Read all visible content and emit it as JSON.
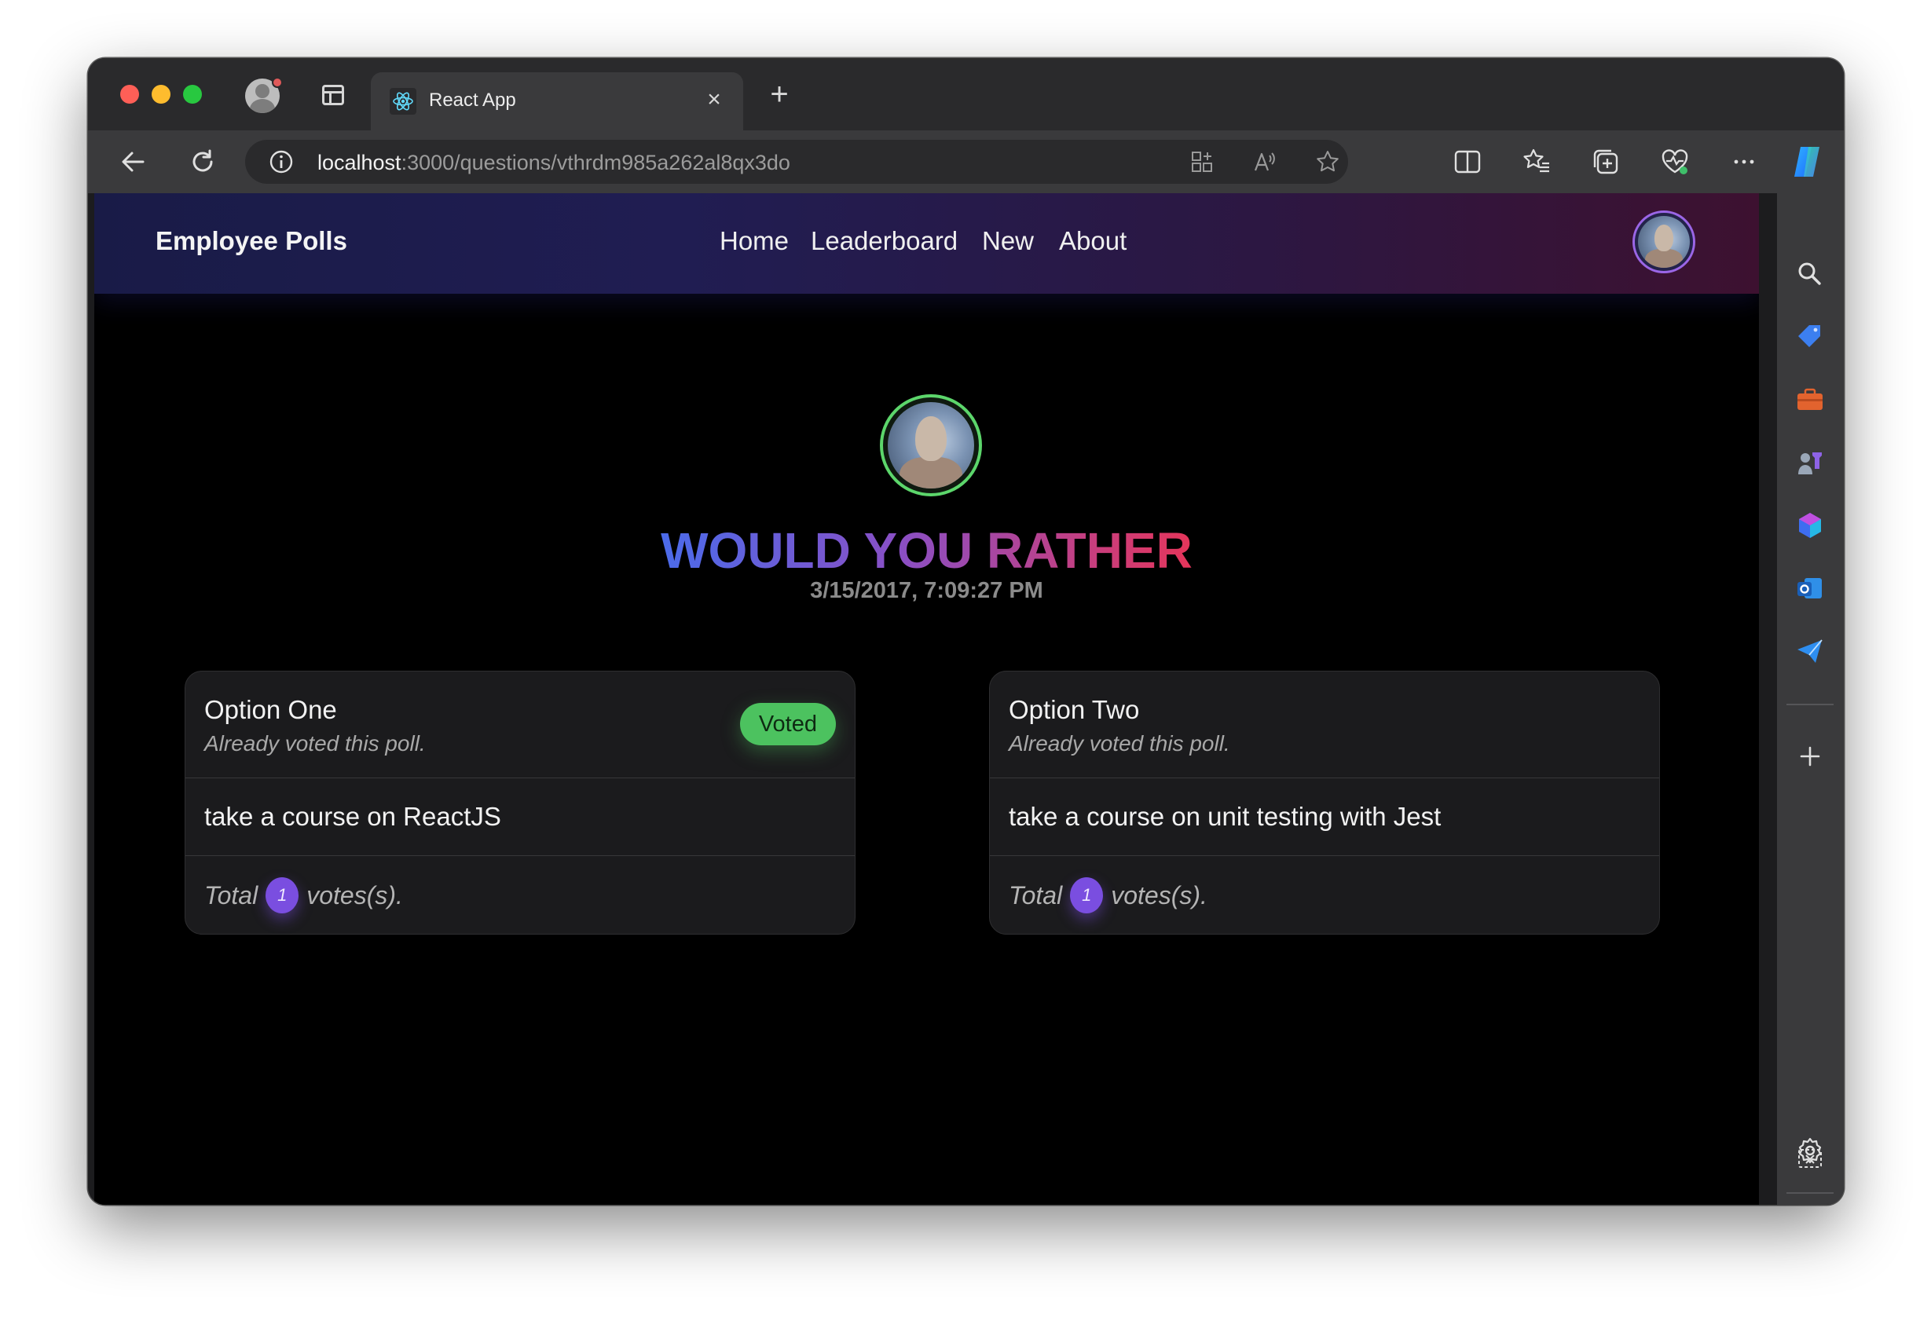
{
  "browser": {
    "tab_title": "React App",
    "tab_close_icon": "×",
    "new_tab_icon": "+",
    "url_host": "localhost",
    "url_rest": ":3000/questions/vthrdm985a262al8qx3do"
  },
  "app": {
    "brand": "Employee Polls",
    "nav": [
      "Home",
      "Leaderboard",
      "New",
      "About"
    ]
  },
  "poll": {
    "title": "WOULD YOU RATHER",
    "date": "3/15/2017, 7:09:27 PM",
    "options": [
      {
        "title": "Option One",
        "subtitle": "Already voted this poll.",
        "badge": "Voted",
        "text": "take a course on ReactJS",
        "total_prefix": "Total",
        "votes": "1",
        "total_suffix": "votes(s)."
      },
      {
        "title": "Option Two",
        "subtitle": "Already voted this poll.",
        "text": "take a course on unit testing with Jest",
        "total_prefix": "Total",
        "votes": "1",
        "total_suffix": "votes(s)."
      }
    ]
  },
  "colors": {
    "accent_green": "#4cc25f",
    "accent_purple": "#7a4ee0",
    "title_gradient_start": "#4b6bea",
    "title_gradient_end": "#e6355a"
  },
  "icons": {
    "toolbar": [
      "back-icon",
      "refresh-icon",
      "info-icon",
      "apps-icon",
      "read-aloud-icon",
      "favorite-icon",
      "split-screen-icon",
      "favorites-icon",
      "collections-icon",
      "browser-essentials-icon",
      "more-icon",
      "copilot-icon"
    ],
    "sidebar": [
      "search-icon",
      "shopping-icon",
      "tools-icon",
      "games-icon",
      "microsoft-365-icon",
      "outlook-icon",
      "drop-icon",
      "add-icon",
      "screenshot-icon",
      "settings-icon"
    ]
  }
}
